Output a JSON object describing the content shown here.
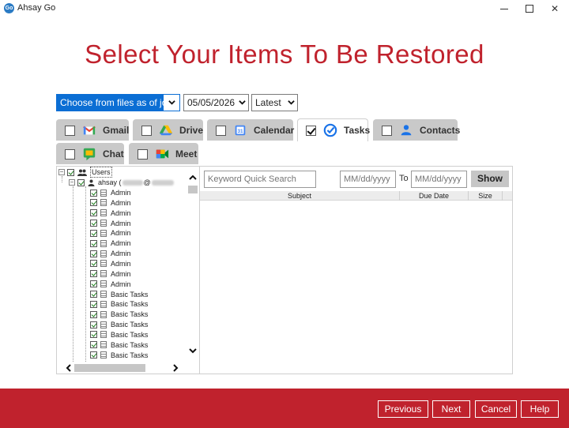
{
  "window": {
    "app_logo": "Go",
    "title": "Ahsay Go",
    "minimize": "",
    "maximize": "",
    "close": "✕"
  },
  "page": {
    "title": "Select Your Items To Be Restored"
  },
  "selectors": {
    "job_mode": "Choose from files as of job",
    "date": "05/05/2026",
    "version": "Latest"
  },
  "tabs": [
    {
      "label": "Gmail",
      "checked": false,
      "icon": "gmail-icon"
    },
    {
      "label": "Drive",
      "checked": false,
      "icon": "drive-icon"
    },
    {
      "label": "Calendar",
      "checked": false,
      "icon": "calendar-icon"
    },
    {
      "label": "Tasks",
      "checked": true,
      "icon": "tasks-icon",
      "active": true
    },
    {
      "label": "Contacts",
      "checked": false,
      "icon": "contacts-icon"
    },
    {
      "label": "Chat",
      "checked": false,
      "icon": "chat-icon"
    },
    {
      "label": "Meet",
      "checked": false,
      "icon": "meet-icon"
    }
  ],
  "tree": {
    "root_label": "Users",
    "user_label": "ahsay (",
    "user_label_mid": "@",
    "items": [
      "Admin",
      "Admin",
      "Admin",
      "Admin",
      "Admin",
      "Admin",
      "Admin",
      "Admin",
      "Admin",
      "Admin",
      "Basic Tasks",
      "Basic Tasks",
      "Basic Tasks",
      "Basic Tasks",
      "Basic Tasks",
      "Basic Tasks",
      "Basic Tasks"
    ]
  },
  "list": {
    "search_placeholder": "Keyword Quick Search",
    "date_from_placeholder": "MM/dd/yyyy",
    "to_label": "To",
    "date_to_placeholder": "MM/dd/yyyy",
    "show_label": "Show",
    "columns": [
      "Subject",
      "Due Date",
      "Size"
    ]
  },
  "footer": {
    "previous": "Previous",
    "next": "Next",
    "cancel": "Cancel",
    "help": "Help"
  },
  "colors": {
    "brand_red": "#c0222d",
    "select_blue": "#0b6ed4"
  }
}
